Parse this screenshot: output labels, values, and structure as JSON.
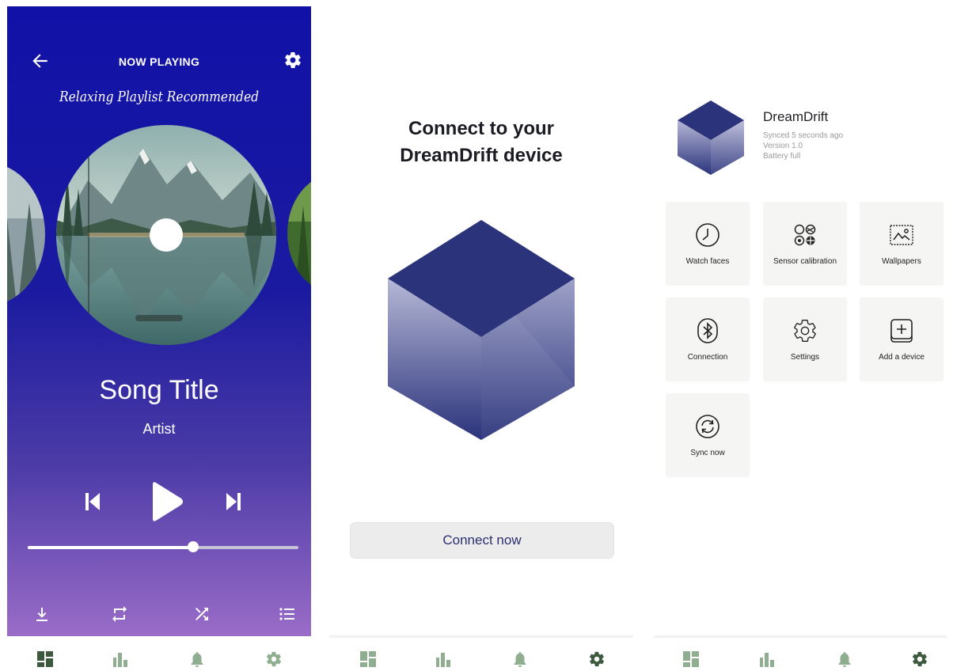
{
  "player": {
    "header_title": "NOW PLAYING",
    "banner": "Relaxing Playlist Recommended",
    "song_title": "Song Title",
    "artist": "Artist",
    "progress": 0.61,
    "icons": [
      "back-arrow-icon",
      "gear-icon",
      "previous-icon",
      "play-icon",
      "next-icon",
      "download-icon",
      "repeat-icon",
      "shuffle-icon",
      "playlist-icon"
    ]
  },
  "connect": {
    "title_line1": "Connect to your",
    "title_line2": "DreamDrift device",
    "button": "Connect now"
  },
  "device": {
    "name": "DreamDrift",
    "synced": "Synced  5 seconds ago",
    "version": "Version 1.0",
    "battery": "Battery full",
    "tiles": [
      {
        "label": "Watch faces",
        "icon": "watch-face-icon"
      },
      {
        "label": "Sensor calibration",
        "icon": "sensor-icon"
      },
      {
        "label": "Wallpapers",
        "icon": "wallpaper-icon"
      },
      {
        "label": "Connection",
        "icon": "bluetooth-icon"
      },
      {
        "label": "Settings",
        "icon": "gear-icon"
      },
      {
        "label": "Add a device",
        "icon": "add-device-icon"
      },
      {
        "label": "Sync now",
        "icon": "sync-icon"
      }
    ]
  },
  "nav": {
    "items": [
      "dashboard-icon",
      "stats-icon",
      "notifications-icon",
      "settings-icon"
    ],
    "active_color": "#3d5a3f",
    "inactive_color": "#8fae8f"
  },
  "colors": {
    "player_top": "#1111a8",
    "player_bottom": "#9a6cc8",
    "cube_dark": "#2b337b",
    "tile_bg": "#f5f5f3"
  }
}
